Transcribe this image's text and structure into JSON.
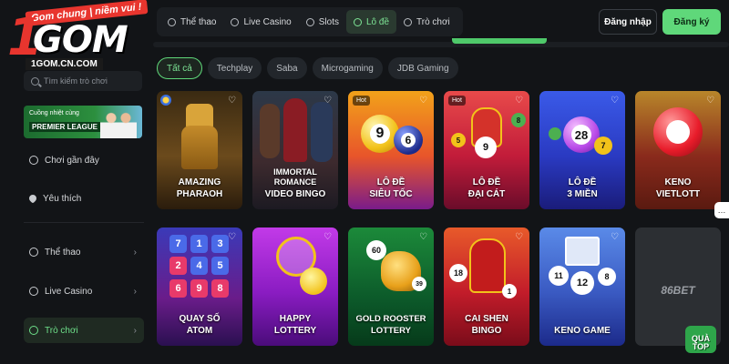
{
  "brand": {
    "tagline": "Gom chung | niềm vui !",
    "logo_one": "1",
    "logo_word": "GOM",
    "url": "1GOM.CN.COM"
  },
  "colors": {
    "accent": "#5fd87a",
    "background": "#121417",
    "panel": "#1b1e22",
    "hot": "#e8352e"
  },
  "topnav": {
    "items": [
      {
        "label": "Thể thao",
        "icon": "soccer-ball-icon"
      },
      {
        "label": "Live Casino",
        "icon": "casino-chip-icon"
      },
      {
        "label": "Slots",
        "icon": "slots-icon"
      },
      {
        "label": "Lô đề",
        "icon": "lottery-icon",
        "active": true
      },
      {
        "label": "Trò chơi",
        "icon": "gamepad-icon"
      }
    ],
    "login": "Đăng nhập",
    "register": "Đăng ký"
  },
  "sidebar": {
    "search_placeholder": "Tìm kiếm trò chơi",
    "promo": {
      "line1": "Cuồng nhiệt cùng",
      "line2": "PREMIER LEAGUE"
    },
    "items": [
      {
        "label": "Chơi gần đây",
        "icon": "clock-icon"
      },
      {
        "label": "Yêu thích",
        "icon": "heart-icon"
      },
      {
        "label": "Thể thao",
        "icon": "soccer-ball-icon",
        "chevron": "›"
      },
      {
        "label": "Live Casino",
        "icon": "casino-chip-icon",
        "chevron": "›"
      },
      {
        "label": "Trò chơi",
        "icon": "gamepad-icon",
        "chevron": "›",
        "active": true
      }
    ]
  },
  "filters": [
    "Tất cả",
    "Techplay",
    "Saba",
    "Microgaming",
    "JDB Gaming"
  ],
  "games": [
    {
      "title_1": "AMAZING",
      "title_2": "PHARAOH"
    },
    {
      "title_1": "IMMORTAL ROMANCE",
      "title_2": "VIDEO BINGO"
    },
    {
      "title_1": "LÔ ĐỀ",
      "title_2": "SIÊU TỐC",
      "hot": "Hot"
    },
    {
      "title_1": "LÔ ĐỀ",
      "title_2": "ĐẠI CÁT",
      "hot": "Hot"
    },
    {
      "title_1": "LÔ ĐỀ",
      "title_2": "3 MIỀN"
    },
    {
      "title_1": "KENO",
      "title_2": "VIETLOTT"
    },
    {
      "title_1": "QUAY SỐ",
      "title_2": "ATOM",
      "tiles": [
        "7",
        "1",
        "3",
        "2",
        "4",
        "5",
        "6",
        "9",
        "8"
      ]
    },
    {
      "title_1": "HAPPY",
      "title_2": "LOTTERY"
    },
    {
      "title_1": "GOLD ROOSTER",
      "title_2": "LOTTERY",
      "balls": [
        "60",
        "39"
      ]
    },
    {
      "title_1": "CAI SHEN",
      "title_2": "BINGO",
      "balls": [
        "18",
        "1"
      ]
    },
    {
      "title_1": "KENO GAME",
      "balls": [
        "11",
        "12",
        "8"
      ]
    },
    {
      "title_1": "86BET"
    }
  ],
  "ball_numbers": {
    "sieu_toc": [
      "9",
      "6"
    ],
    "dai_cat": [
      "5",
      "9",
      "8"
    ],
    "ba_mien": [
      "28",
      "7"
    ]
  },
  "fav_glyph": "♡",
  "gift_label": "QUÀ TOP",
  "chat_glyph": "…"
}
